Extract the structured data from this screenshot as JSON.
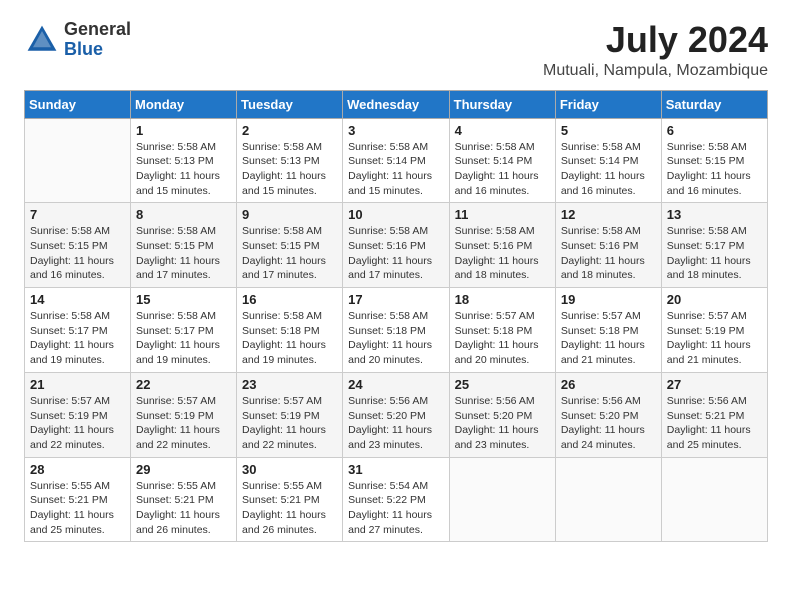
{
  "header": {
    "logo_general": "General",
    "logo_blue": "Blue",
    "month_year": "July 2024",
    "location": "Mutuali, Nampula, Mozambique"
  },
  "days_of_week": [
    "Sunday",
    "Monday",
    "Tuesday",
    "Wednesday",
    "Thursday",
    "Friday",
    "Saturday"
  ],
  "weeks": [
    [
      {
        "day": "",
        "info": ""
      },
      {
        "day": "1",
        "info": "Sunrise: 5:58 AM\nSunset: 5:13 PM\nDaylight: 11 hours\nand 15 minutes."
      },
      {
        "day": "2",
        "info": "Sunrise: 5:58 AM\nSunset: 5:13 PM\nDaylight: 11 hours\nand 15 minutes."
      },
      {
        "day": "3",
        "info": "Sunrise: 5:58 AM\nSunset: 5:14 PM\nDaylight: 11 hours\nand 15 minutes."
      },
      {
        "day": "4",
        "info": "Sunrise: 5:58 AM\nSunset: 5:14 PM\nDaylight: 11 hours\nand 16 minutes."
      },
      {
        "day": "5",
        "info": "Sunrise: 5:58 AM\nSunset: 5:14 PM\nDaylight: 11 hours\nand 16 minutes."
      },
      {
        "day": "6",
        "info": "Sunrise: 5:58 AM\nSunset: 5:15 PM\nDaylight: 11 hours\nand 16 minutes."
      }
    ],
    [
      {
        "day": "7",
        "info": "Sunrise: 5:58 AM\nSunset: 5:15 PM\nDaylight: 11 hours\nand 16 minutes."
      },
      {
        "day": "8",
        "info": "Sunrise: 5:58 AM\nSunset: 5:15 PM\nDaylight: 11 hours\nand 17 minutes."
      },
      {
        "day": "9",
        "info": "Sunrise: 5:58 AM\nSunset: 5:15 PM\nDaylight: 11 hours\nand 17 minutes."
      },
      {
        "day": "10",
        "info": "Sunrise: 5:58 AM\nSunset: 5:16 PM\nDaylight: 11 hours\nand 17 minutes."
      },
      {
        "day": "11",
        "info": "Sunrise: 5:58 AM\nSunset: 5:16 PM\nDaylight: 11 hours\nand 18 minutes."
      },
      {
        "day": "12",
        "info": "Sunrise: 5:58 AM\nSunset: 5:16 PM\nDaylight: 11 hours\nand 18 minutes."
      },
      {
        "day": "13",
        "info": "Sunrise: 5:58 AM\nSunset: 5:17 PM\nDaylight: 11 hours\nand 18 minutes."
      }
    ],
    [
      {
        "day": "14",
        "info": "Sunrise: 5:58 AM\nSunset: 5:17 PM\nDaylight: 11 hours\nand 19 minutes."
      },
      {
        "day": "15",
        "info": "Sunrise: 5:58 AM\nSunset: 5:17 PM\nDaylight: 11 hours\nand 19 minutes."
      },
      {
        "day": "16",
        "info": "Sunrise: 5:58 AM\nSunset: 5:18 PM\nDaylight: 11 hours\nand 19 minutes."
      },
      {
        "day": "17",
        "info": "Sunrise: 5:58 AM\nSunset: 5:18 PM\nDaylight: 11 hours\nand 20 minutes."
      },
      {
        "day": "18",
        "info": "Sunrise: 5:57 AM\nSunset: 5:18 PM\nDaylight: 11 hours\nand 20 minutes."
      },
      {
        "day": "19",
        "info": "Sunrise: 5:57 AM\nSunset: 5:18 PM\nDaylight: 11 hours\nand 21 minutes."
      },
      {
        "day": "20",
        "info": "Sunrise: 5:57 AM\nSunset: 5:19 PM\nDaylight: 11 hours\nand 21 minutes."
      }
    ],
    [
      {
        "day": "21",
        "info": "Sunrise: 5:57 AM\nSunset: 5:19 PM\nDaylight: 11 hours\nand 22 minutes."
      },
      {
        "day": "22",
        "info": "Sunrise: 5:57 AM\nSunset: 5:19 PM\nDaylight: 11 hours\nand 22 minutes."
      },
      {
        "day": "23",
        "info": "Sunrise: 5:57 AM\nSunset: 5:19 PM\nDaylight: 11 hours\nand 22 minutes."
      },
      {
        "day": "24",
        "info": "Sunrise: 5:56 AM\nSunset: 5:20 PM\nDaylight: 11 hours\nand 23 minutes."
      },
      {
        "day": "25",
        "info": "Sunrise: 5:56 AM\nSunset: 5:20 PM\nDaylight: 11 hours\nand 23 minutes."
      },
      {
        "day": "26",
        "info": "Sunrise: 5:56 AM\nSunset: 5:20 PM\nDaylight: 11 hours\nand 24 minutes."
      },
      {
        "day": "27",
        "info": "Sunrise: 5:56 AM\nSunset: 5:21 PM\nDaylight: 11 hours\nand 25 minutes."
      }
    ],
    [
      {
        "day": "28",
        "info": "Sunrise: 5:55 AM\nSunset: 5:21 PM\nDaylight: 11 hours\nand 25 minutes."
      },
      {
        "day": "29",
        "info": "Sunrise: 5:55 AM\nSunset: 5:21 PM\nDaylight: 11 hours\nand 26 minutes."
      },
      {
        "day": "30",
        "info": "Sunrise: 5:55 AM\nSunset: 5:21 PM\nDaylight: 11 hours\nand 26 minutes."
      },
      {
        "day": "31",
        "info": "Sunrise: 5:54 AM\nSunset: 5:22 PM\nDaylight: 11 hours\nand 27 minutes."
      },
      {
        "day": "",
        "info": ""
      },
      {
        "day": "",
        "info": ""
      },
      {
        "day": "",
        "info": ""
      }
    ]
  ]
}
